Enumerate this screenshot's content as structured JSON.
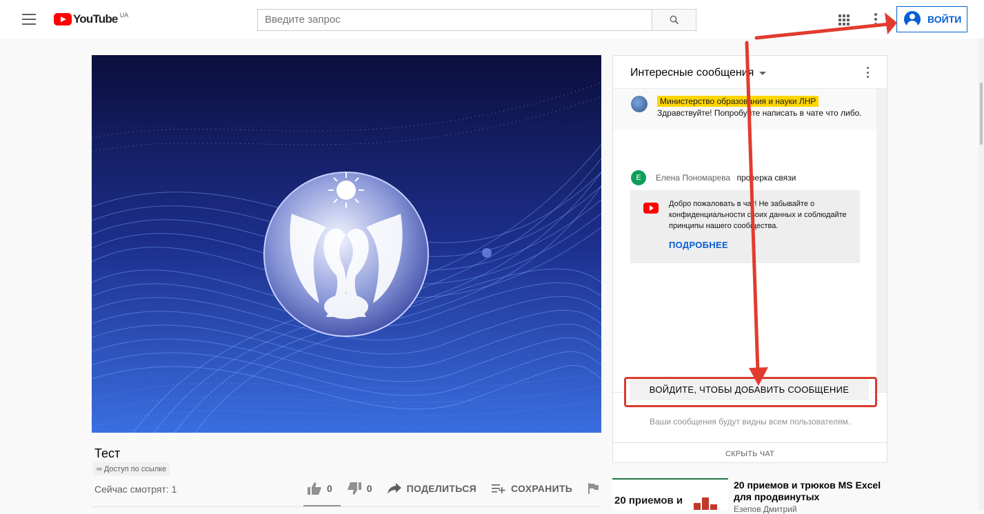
{
  "header": {
    "logo_text": "YouTube",
    "logo_country": "UA",
    "search_placeholder": "Введите запрос",
    "signin_label": "ВОЙТИ"
  },
  "video": {
    "title": "Тест",
    "access_badge": "Доступ по ссылке",
    "watching_now": "Сейчас смотрят: 1",
    "likes": "0",
    "dislikes": "0",
    "share_label": "ПОДЕЛИТЬСЯ",
    "save_label": "СОХРАНИТЬ"
  },
  "chat": {
    "title": "Интересные сообщения",
    "messages": [
      {
        "author": "Министерство образования и науки ЛНР",
        "text": "Здравствуйте! Попробуйте написать в чате что либо."
      },
      {
        "author": "Елена Пономарева",
        "avatar_letter": "E",
        "text": "проверка связи"
      }
    ],
    "welcome_text": "Добро пожаловать в чат! Не забывайте о конфиденциальности своих данных и соблюдайте принципы нашего сообщества.",
    "more_link": "ПОДРОБНЕЕ",
    "signin_to_chat": "ВОЙДИТЕ, ЧТОБЫ ДОБАВИТЬ СООБЩЕНИЕ",
    "visibility_note": "Ваши сообщения будут видны всем пользователям.",
    "hide_chat": "СКРЫТЬ ЧАТ"
  },
  "recommendation": {
    "thumb_text": "20 приемов и",
    "title": "20 приемов и трюков MS Excel для продвинутых",
    "author": "Езепов Дмитрий"
  },
  "colors": {
    "brand_red": "#ff0000",
    "link_blue": "#065fd4",
    "annotation_red": "#d93b2f",
    "highlight_yellow": "#ffd600"
  }
}
